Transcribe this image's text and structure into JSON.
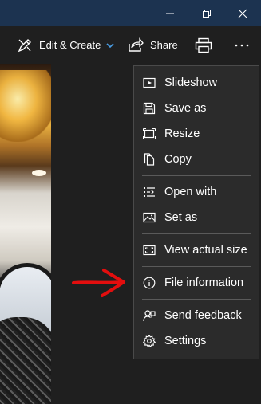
{
  "window": {
    "controls": [
      "minimize-icon",
      "restore-icon",
      "close-icon"
    ]
  },
  "toolbar": {
    "edit_create_label": "Edit & Create",
    "share_label": "Share",
    "icons": [
      "edit-create-icon",
      "chevron-down-icon",
      "share-icon",
      "print-icon",
      "more-icon"
    ]
  },
  "menu": {
    "items": [
      {
        "label": "Slideshow",
        "icon": "slideshow-icon"
      },
      {
        "label": "Save as",
        "icon": "save-icon"
      },
      {
        "label": "Resize",
        "icon": "resize-icon"
      },
      {
        "label": "Copy",
        "icon": "copy-icon"
      },
      {
        "label": "Open with",
        "icon": "open-with-icon"
      },
      {
        "label": "Set as",
        "icon": "set-as-icon"
      },
      {
        "label": "View actual size",
        "icon": "actual-size-icon"
      },
      {
        "label": "File information",
        "icon": "info-icon"
      },
      {
        "label": "Send feedback",
        "icon": "feedback-icon"
      },
      {
        "label": "Settings",
        "icon": "settings-icon"
      }
    ]
  },
  "colors": {
    "titlebar": "#1c3350",
    "background": "#1f1f1f",
    "menu_bg": "#2b2b2b",
    "accent": "#4a9fe8",
    "annotation": "#e30e0e"
  }
}
